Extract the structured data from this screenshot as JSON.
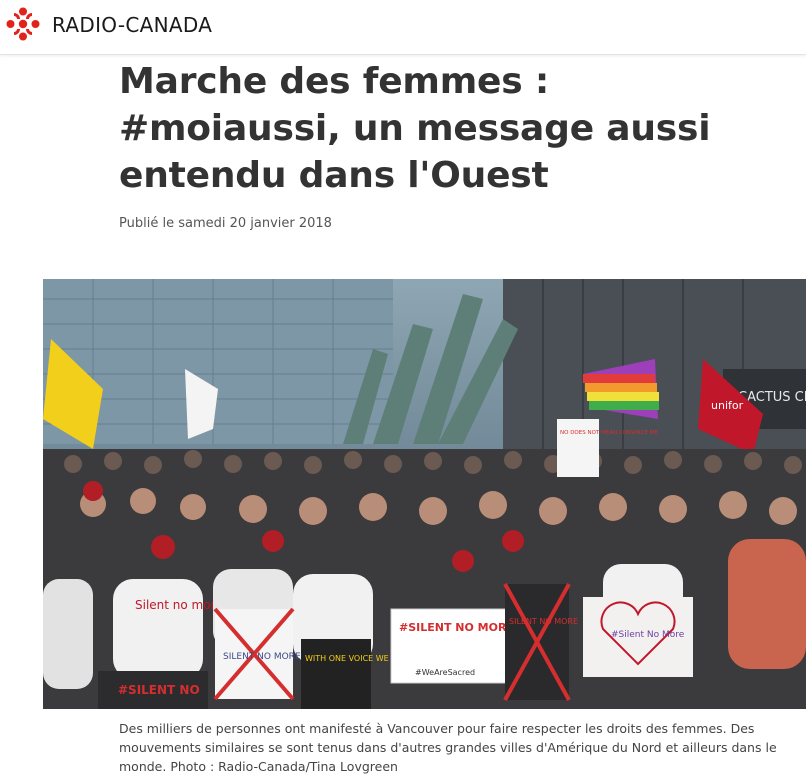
{
  "header": {
    "logo_text": "RADIO-CANADA",
    "logo_icon": "radio-canada-gem-icon",
    "brand_color": "#e2231a"
  },
  "article": {
    "title": "Marche des femmes : #moiaussi, un message aussi entendu dans l'Ouest",
    "published": "Publié le samedi 20 janvier 2018",
    "caption": "Des milliers de personnes ont manifesté à Vancouver pour faire respecter les droits des femmes. Des mouvements similaires se sont tenus dans d'autres grandes villes d'Amérique du Nord et ailleurs dans le monde. Photo : Radio-Canada/Tina Lovgreen"
  },
  "photo": {
    "signs": {
      "silent_no_more_1": "#SILENT NO MORE",
      "silent_no_more_2": "SILENT NO MORE",
      "we_are_sacred": "#WeAreSacred",
      "silent_no_more_x": "SILENT NO MORE",
      "silent_heart": "#Silent No More",
      "one_voice": "WITH ONE VOICE WE CAN",
      "bottom_left": "#SILENT NO",
      "no_does_not": "NO DOES NOT MEAN CONVINCE ME",
      "cactus_club": "CACTUS CLUB",
      "shirt_text": "Silent no more",
      "unifor": "unifor"
    }
  }
}
